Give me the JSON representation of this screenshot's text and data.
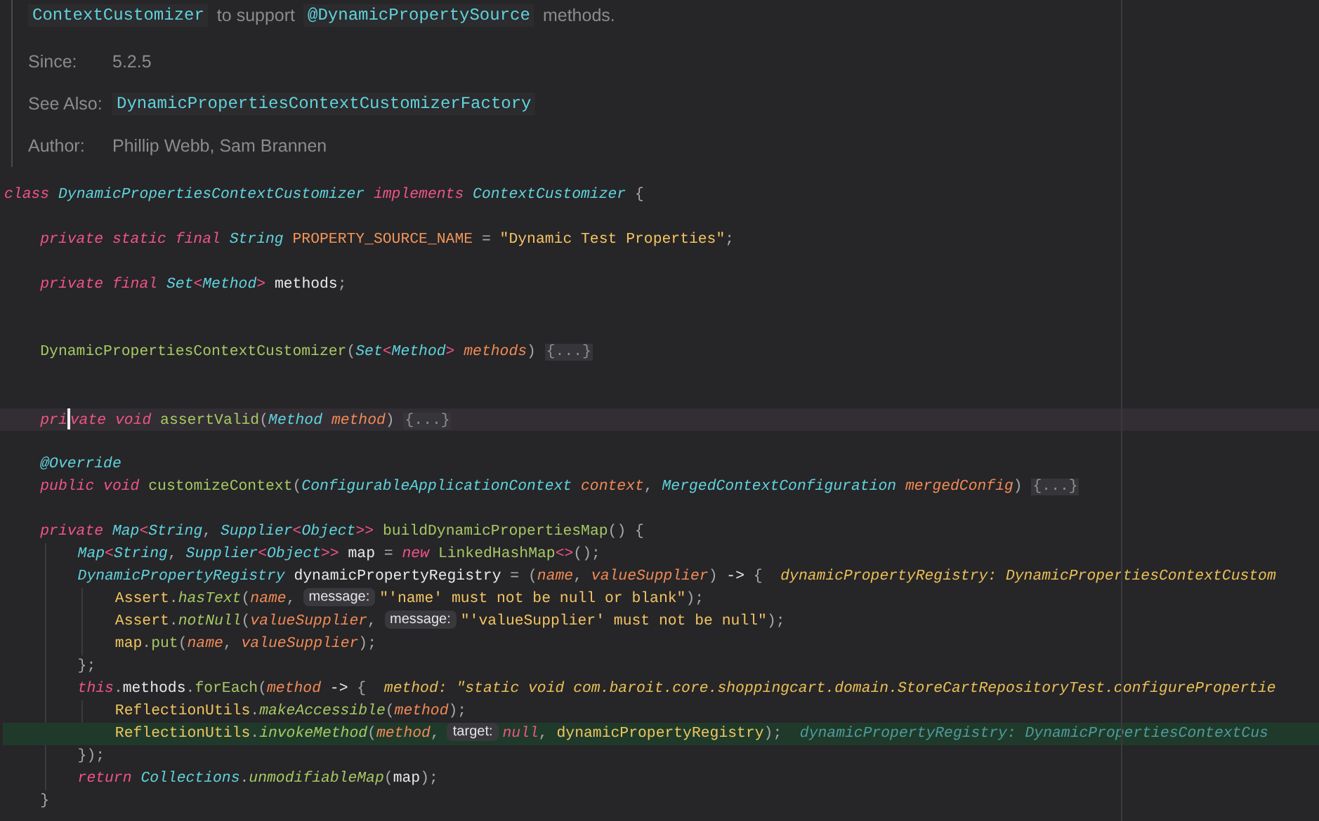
{
  "doc": {
    "summary": [
      {
        "t": "ContextCustomizer",
        "kind": "code"
      },
      {
        "t": "to support",
        "kind": "text"
      },
      {
        "t": "@DynamicPropertySource",
        "kind": "code"
      },
      {
        "t": "methods.",
        "kind": "text"
      }
    ],
    "tags": [
      {
        "label": "Since:",
        "values": [
          {
            "t": "5.2.5",
            "kind": "text"
          }
        ]
      },
      {
        "label": "See Also:",
        "values": [
          {
            "t": "DynamicPropertiesContextCustomizerFactory",
            "kind": "code"
          }
        ]
      },
      {
        "label": "Author:",
        "values": [
          {
            "t": "Phillip Webb, Sam Brannen",
            "kind": "text"
          }
        ]
      }
    ]
  },
  "code": [
    {
      "current_line": false,
      "execution_point": false,
      "tokens": [
        {
          "t": "class",
          "kind": "keyword"
        },
        {
          "t": " DynamicPropertiesContextCustomizer",
          "kind": "type"
        },
        {
          "t": " implements",
          "kind": "keyword"
        },
        {
          "t": " ContextCustomizer",
          "kind": "type"
        },
        {
          "t": " {",
          "kind": "punct"
        }
      ],
      "children": [
        {
          "current_line": false,
          "execution_point": false
        },
        {
          "current_line": false,
          "execution_point": false,
          "tokens": [
            {
              "t": "private static final",
              "kind": "keyword"
            },
            {
              "t": " String",
              "kind": "type"
            },
            {
              "t": " PROPERTY_SOURCE_NAME",
              "kind": "field"
            },
            {
              "t": " =",
              "kind": "punct"
            },
            {
              "t": " \"Dynamic Test Properties\"",
              "kind": "string"
            },
            {
              "t": ";",
              "kind": "punct"
            }
          ]
        },
        {
          "current_line": false,
          "execution_point": false
        },
        {
          "current_line": false,
          "execution_point": false,
          "tokens": [
            {
              "t": "private final",
              "kind": "keyword"
            },
            {
              "t": " Set",
              "kind": "type"
            },
            {
              "t": "<",
              "kind": "keyword"
            },
            {
              "t": "Method",
              "kind": "type"
            },
            {
              "t": ">",
              "kind": "keyword"
            },
            {
              "t": " methods",
              "kind": "ident"
            },
            {
              "t": ";",
              "kind": "punct"
            }
          ]
        },
        {
          "current_line": false,
          "execution_point": false
        },
        {
          "current_line": false,
          "execution_point": false
        },
        {
          "current_line": false,
          "execution_point": false,
          "tokens": [
            {
              "t": "DynamicPropertiesContextCustomizer",
              "kind": "decl"
            },
            {
              "t": "(",
              "kind": "punct"
            },
            {
              "t": "Set",
              "kind": "type"
            },
            {
              "t": "<",
              "kind": "keyword"
            },
            {
              "t": "Method",
              "kind": "type"
            },
            {
              "t": ">",
              "kind": "keyword"
            },
            {
              "t": " methods",
              "kind": "param"
            },
            {
              "t": ")",
              "kind": "punct"
            },
            {
              "t": " {...}",
              "kind": "fold"
            }
          ]
        },
        {
          "current_line": false,
          "execution_point": false
        },
        {
          "current_line": false,
          "execution_point": false
        },
        {
          "current_line": true,
          "execution_point": false,
          "tokens": [
            {
              "t": "pri",
              "kind": "keyword",
              "caret_after": true
            },
            {
              "t": "vate void",
              "kind": "keyword"
            },
            {
              "t": " assertValid",
              "kind": "decl"
            },
            {
              "t": "(",
              "kind": "punct"
            },
            {
              "t": "Method",
              "kind": "type"
            },
            {
              "t": " method",
              "kind": "param"
            },
            {
              "t": ")",
              "kind": "punct"
            },
            {
              "t": " {...}",
              "kind": "fold"
            }
          ]
        },
        {
          "current_line": false,
          "execution_point": false
        },
        {
          "current_line": false,
          "execution_point": false,
          "tokens": [
            {
              "t": "@Override",
              "kind": "annotation"
            }
          ]
        },
        {
          "current_line": false,
          "execution_point": false,
          "tokens": [
            {
              "t": "public void",
              "kind": "keyword"
            },
            {
              "t": " customizeContext",
              "kind": "decl"
            },
            {
              "t": "(",
              "kind": "punct"
            },
            {
              "t": "ConfigurableApplicationContext",
              "kind": "type"
            },
            {
              "t": " context",
              "kind": "param"
            },
            {
              "t": ",",
              "kind": "punct"
            },
            {
              "t": " MergedContextConfiguration",
              "kind": "type"
            },
            {
              "t": " mergedConfig",
              "kind": "param"
            },
            {
              "t": ")",
              "kind": "punct"
            },
            {
              "t": " {...}",
              "kind": "fold"
            }
          ]
        },
        {
          "current_line": false,
          "execution_point": false
        },
        {
          "current_line": false,
          "execution_point": false,
          "tokens": [
            {
              "t": "private",
              "kind": "keyword"
            },
            {
              "t": " Map",
              "kind": "type"
            },
            {
              "t": "<",
              "kind": "keyword"
            },
            {
              "t": "String",
              "kind": "type"
            },
            {
              "t": ",",
              "kind": "punct"
            },
            {
              "t": " Supplier",
              "kind": "type"
            },
            {
              "t": "<",
              "kind": "keyword"
            },
            {
              "t": "Object",
              "kind": "type"
            },
            {
              "t": ">>",
              "kind": "keyword"
            },
            {
              "t": " buildDynamicPropertiesMap",
              "kind": "decl"
            },
            {
              "t": "() {",
              "kind": "punct"
            }
          ],
          "children": [
            {
              "current_line": false,
              "execution_point": false,
              "tokens": [
                {
                  "t": "Map",
                  "kind": "type"
                },
                {
                  "t": "<",
                  "kind": "keyword"
                },
                {
                  "t": "String",
                  "kind": "type"
                },
                {
                  "t": ",",
                  "kind": "punct"
                },
                {
                  "t": " Supplier",
                  "kind": "type"
                },
                {
                  "t": "<",
                  "kind": "keyword"
                },
                {
                  "t": "Object",
                  "kind": "type"
                },
                {
                  "t": ">>",
                  "kind": "keyword"
                },
                {
                  "t": " map",
                  "kind": "ident"
                },
                {
                  "t": " =",
                  "kind": "punct"
                },
                {
                  "t": " new",
                  "kind": "keyword"
                },
                {
                  "t": " LinkedHashMap",
                  "kind": "call"
                },
                {
                  "t": "<>",
                  "kind": "keyword"
                },
                {
                  "t": "();",
                  "kind": "punct"
                }
              ]
            },
            {
              "current_line": false,
              "execution_point": false,
              "tokens": [
                {
                  "t": "DynamicPropertyRegistry",
                  "kind": "type"
                },
                {
                  "t": " dynamicPropertyRegistry",
                  "kind": "ident"
                },
                {
                  "t": " =",
                  "kind": "punct"
                },
                {
                  "t": " (",
                  "kind": "punct"
                },
                {
                  "t": "name",
                  "kind": "param"
                },
                {
                  "t": ",",
                  "kind": "punct"
                },
                {
                  "t": " valueSupplier",
                  "kind": "param"
                },
                {
                  "t": ")",
                  "kind": "punct"
                },
                {
                  "t": " ->",
                  "kind": "ident"
                },
                {
                  "t": " {",
                  "kind": "punct"
                },
                {
                  "t": "dynamicPropertyRegistry: DynamicPropertiesContextCustom",
                  "kind": "value-hint"
                }
              ],
              "children": [
                {
                  "current_line": false,
                  "execution_point": false,
                  "tokens": [
                    {
                      "t": "Assert",
                      "kind": "classref"
                    },
                    {
                      "t": ".",
                      "kind": "punct"
                    },
                    {
                      "t": "hasText",
                      "kind": "static-call"
                    },
                    {
                      "t": "(",
                      "kind": "punct"
                    },
                    {
                      "t": "name",
                      "kind": "param"
                    },
                    {
                      "t": ",",
                      "kind": "punct"
                    },
                    {
                      "t": "message:",
                      "kind": "param-hint"
                    },
                    {
                      "t": "\"'name' must not be null or blank\"",
                      "kind": "string"
                    },
                    {
                      "t": ");",
                      "kind": "punct"
                    }
                  ]
                },
                {
                  "current_line": false,
                  "execution_point": false,
                  "tokens": [
                    {
                      "t": "Assert",
                      "kind": "classref"
                    },
                    {
                      "t": ".",
                      "kind": "punct"
                    },
                    {
                      "t": "notNull",
                      "kind": "static-call"
                    },
                    {
                      "t": "(",
                      "kind": "punct"
                    },
                    {
                      "t": "valueSupplier",
                      "kind": "param"
                    },
                    {
                      "t": ",",
                      "kind": "punct"
                    },
                    {
                      "t": "message:",
                      "kind": "param-hint"
                    },
                    {
                      "t": "\"'valueSupplier' must not be null\"",
                      "kind": "string"
                    },
                    {
                      "t": ");",
                      "kind": "punct"
                    }
                  ]
                },
                {
                  "current_line": false,
                  "execution_point": false,
                  "tokens": [
                    {
                      "t": "map",
                      "kind": "classref"
                    },
                    {
                      "t": ".",
                      "kind": "punct"
                    },
                    {
                      "t": "put",
                      "kind": "call"
                    },
                    {
                      "t": "(",
                      "kind": "punct"
                    },
                    {
                      "t": "name",
                      "kind": "param"
                    },
                    {
                      "t": ",",
                      "kind": "punct"
                    },
                    {
                      "t": " valueSupplier",
                      "kind": "param"
                    },
                    {
                      "t": ");",
                      "kind": "punct"
                    }
                  ]
                }
              ]
            },
            {
              "current_line": false,
              "execution_point": false,
              "tokens": [
                {
                  "t": "};",
                  "kind": "punct"
                }
              ]
            },
            {
              "current_line": false,
              "execution_point": false,
              "tokens": [
                {
                  "t": "this",
                  "kind": "keyword"
                },
                {
                  "t": ".",
                  "kind": "punct"
                },
                {
                  "t": "methods",
                  "kind": "ident"
                },
                {
                  "t": ".",
                  "kind": "punct"
                },
                {
                  "t": "forEach",
                  "kind": "call"
                },
                {
                  "t": "(",
                  "kind": "punct"
                },
                {
                  "t": "method",
                  "kind": "param"
                },
                {
                  "t": " ->",
                  "kind": "ident"
                },
                {
                  "t": " {",
                  "kind": "punct"
                },
                {
                  "t": "method: \"static void com.baroit.core.shoppingcart.domain.StoreCartRepositoryTest.configurePropertie",
                  "kind": "value-hint"
                }
              ],
              "children": [
                {
                  "current_line": false,
                  "execution_point": false,
                  "tokens": [
                    {
                      "t": "ReflectionUtils",
                      "kind": "classref"
                    },
                    {
                      "t": ".",
                      "kind": "punct"
                    },
                    {
                      "t": "makeAccessible",
                      "kind": "static-call"
                    },
                    {
                      "t": "(",
                      "kind": "punct"
                    },
                    {
                      "t": "method",
                      "kind": "param"
                    },
                    {
                      "t": ");",
                      "kind": "punct"
                    }
                  ]
                },
                {
                  "current_line": false,
                  "execution_point": true,
                  "tokens": [
                    {
                      "t": "ReflectionUtils",
                      "kind": "classref"
                    },
                    {
                      "t": ".",
                      "kind": "punct"
                    },
                    {
                      "t": "invokeMethod",
                      "kind": "static-call"
                    },
                    {
                      "t": "(",
                      "kind": "punct"
                    },
                    {
                      "t": "method",
                      "kind": "param"
                    },
                    {
                      "t": ",",
                      "kind": "punct"
                    },
                    {
                      "t": "target:",
                      "kind": "param-hint"
                    },
                    {
                      "t": "null",
                      "kind": "keyword"
                    },
                    {
                      "t": ",",
                      "kind": "punct"
                    },
                    {
                      "t": " dynamicPropertyRegistry",
                      "kind": "classref"
                    },
                    {
                      "t": ");",
                      "kind": "punct"
                    },
                    {
                      "t": "dynamicPropertyRegistry: DynamicPropertiesContextCus",
                      "kind": "value-hint"
                    }
                  ]
                }
              ]
            },
            {
              "current_line": false,
              "execution_point": false,
              "tokens": [
                {
                  "t": "});",
                  "kind": "punct"
                }
              ]
            },
            {
              "current_line": false,
              "execution_point": false,
              "tokens": [
                {
                  "t": "return",
                  "kind": "keyword"
                },
                {
                  "t": " Collections",
                  "kind": "type"
                },
                {
                  "t": ".",
                  "kind": "punct"
                },
                {
                  "t": "unmodifiableMap",
                  "kind": "static-call"
                },
                {
                  "t": "(",
                  "kind": "punct"
                },
                {
                  "t": "map",
                  "kind": "ident"
                },
                {
                  "t": ");",
                  "kind": "punct"
                }
              ]
            }
          ]
        },
        {
          "current_line": false,
          "execution_point": false,
          "tokens": [
            {
              "t": "}",
              "kind": "punct"
            }
          ]
        }
      ]
    }
  ]
}
